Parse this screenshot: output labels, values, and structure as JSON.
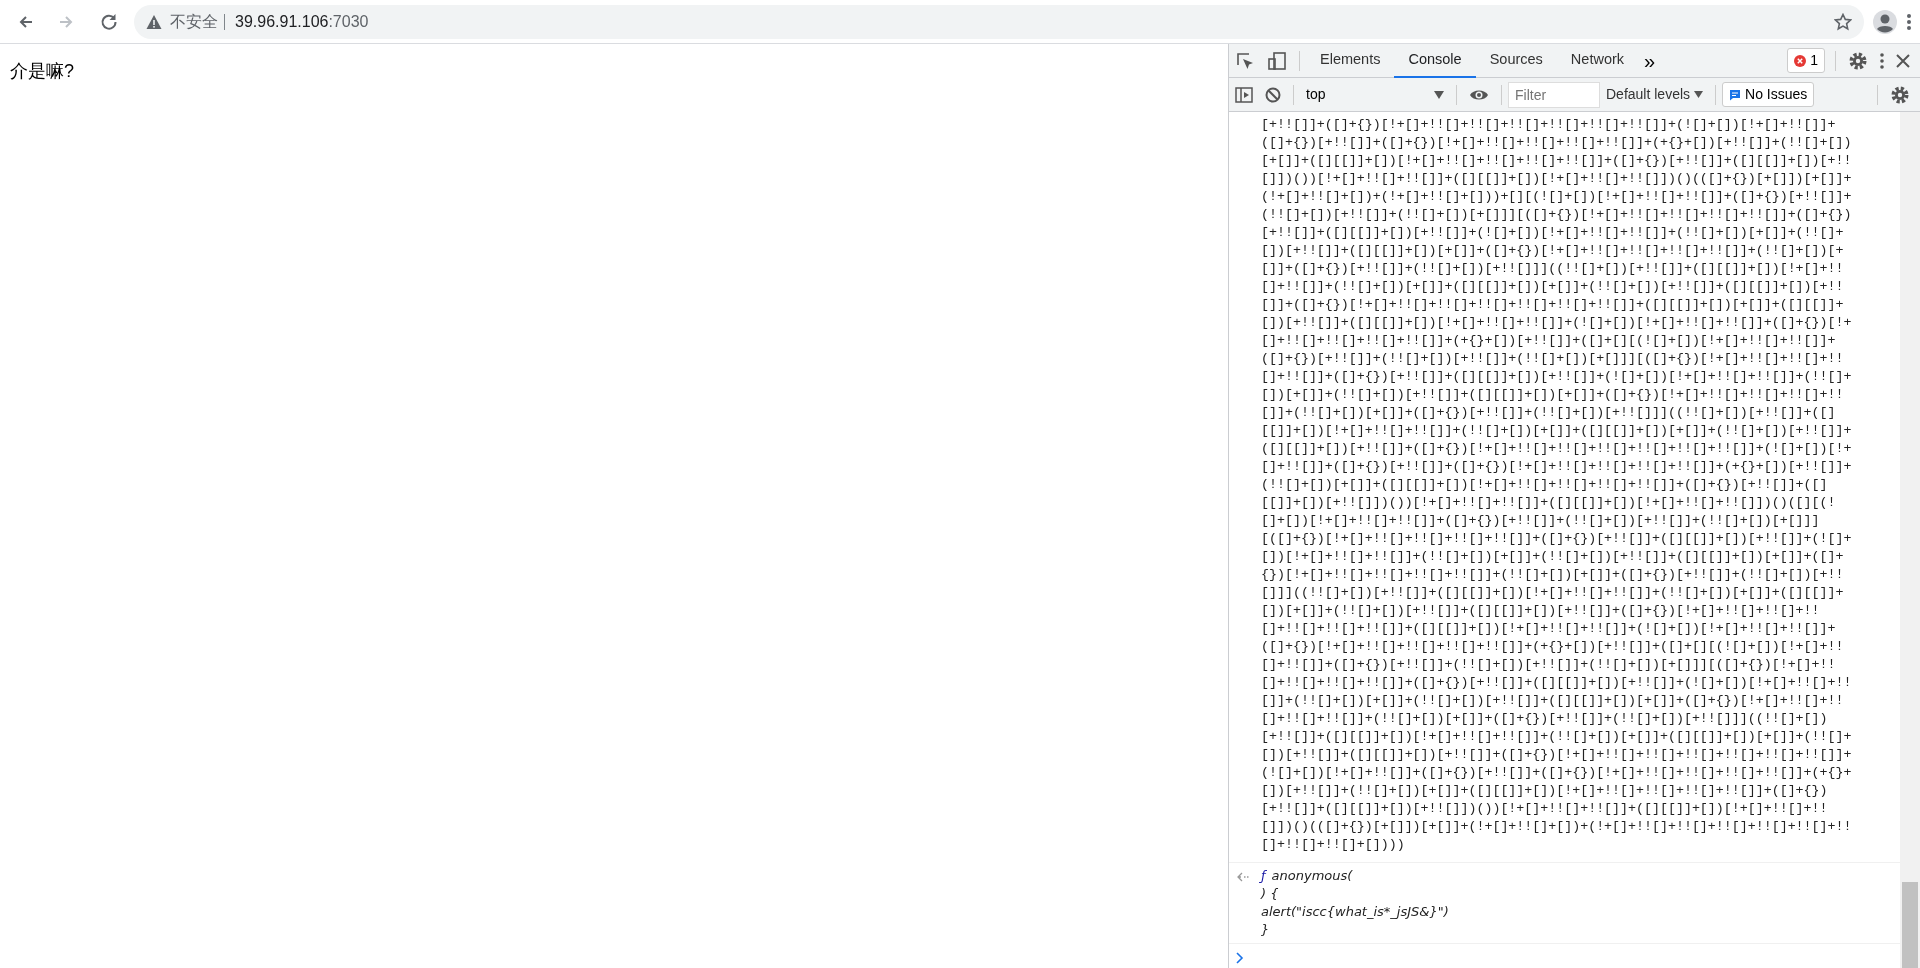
{
  "browser": {
    "navigation": [
      {
        "kind": "back",
        "disabled": false
      },
      {
        "kind": "forward",
        "disabled": true
      },
      {
        "kind": "reload",
        "disabled": false
      }
    ],
    "address": {
      "security_label": "不安全",
      "host": "39.96.91.106",
      "port": ":7030"
    }
  },
  "page": {
    "text": "介是嘛?"
  },
  "devtools": {
    "tabs": [
      {
        "label": "Elements",
        "selected": false
      },
      {
        "label": "Console",
        "selected": true
      },
      {
        "label": "Sources",
        "selected": false
      },
      {
        "label": "Network",
        "selected": false
      }
    ],
    "more": "»",
    "error_count": "1",
    "toolbar": {
      "context": "top",
      "filter": {
        "placeholder": "Filter"
      },
      "levels": "Default levels",
      "issues": "No Issues"
    },
    "console": {
      "code_lines": [
        "[+!![]]+([]+{})[!+[]+!![]+!![]+!![]+!![]+!![]+!![]]+(![]+[])[!+[]+!![]]+",
        "([]+{})[+!![]]+([]+{})[!+[]+!![]+!![]+!![]+!![]]+(+{}+[])[+!![]]+(!![]+[])",
        "[+[]]+([][[]]+[])[!+[]+!![]+!![]+!![]+!![]]+([]+{})[+!![]]+([][[]]+[])[+!!",
        "[]])())[!+[]+!![]+!![]]+([][[]]+[])[!+[]+!![]+!![]])()(([]+{})[+[]])[+[]]+",
        "(!+[]+!![]+[])+(!+[]+!![]+[]))+[][(![]+[])[!+[]+!![]+!![]]+([]+{})[+!![]]+",
        "(!![]+[])[+!![]]+(!![]+[])[+[]]][([]+{})[!+[]+!![]+!![]+!![]+!![]]+([]+{})",
        "[+!![]]+([][[]]+[])[+!![]]+(![]+[])[!+[]+!![]+!![]]+(!![]+[])[+[]]+(!![]+",
        "[])[+!![]]+([][[]]+[])[+[]]+([]+{})[!+[]+!![]+!![]+!![]+!![]]+(!![]+[])[+",
        "[]]+([]+{})[+!![]]+(!![]+[])[+!![]]]((!![]+[])[+!![]]+([][[]]+[])[!+[]+!!",
        "[]+!![]]+(!![]+[])[+[]]+([][[]]+[])[+[]]+(!![]+[])[+!![]]+([][[]]+[])[+!!",
        "[]]+([]+{})[!+[]+!![]+!![]+!![]+!![]+!![]+!![]]+([][[]]+[])[+[]]+([][[]]+",
        "[])[+!![]]+([][[]]+[])[!+[]+!![]+!![]]+(![]+[])[!+[]+!![]+!![]]+([]+{})[!+",
        "[]+!![]+!![]+!![]+!![]]+(+{}+[])[+!![]]+([]+[][(![]+[])[!+[]+!![]+!![]]+",
        "([]+{})[+!![]]+(!![]+[])[+!![]]+(!![]+[])[+[]]][([]+{})[!+[]+!![]+!![]+!!",
        "[]+!![]]+([]+{})[+!![]]+([][[]]+[])[+!![]]+(![]+[])[!+[]+!![]+!![]]+(!![]+",
        "[])[+[]]+(!![]+[])[+!![]]+([][[]]+[])[+[]]+([]+{})[!+[]+!![]+!![]+!![]+!!",
        "[]]+(!![]+[])[+[]]+([]+{})[+!![]]+(!![]+[])[+!![]]]((!![]+[])[+!![]]+([]",
        "[[]]+[])[!+[]+!![]+!![]]+(!![]+[])[+[]]+([][[]]+[])[+[]]+(!![]+[])[+!![]]+",
        "([][[]]+[])[+!![]]+([]+{})[!+[]+!![]+!![]+!![]+!![]+!![]+!![]]+(![]+[])[!+",
        "[]+!![]]+([]+{})[+!![]]+([]+{})[!+[]+!![]+!![]+!![]+!![]]+(+{}+[])[+!![]]+",
        "(!![]+[])[+[]]+([][[]]+[])[!+[]+!![]+!![]+!![]+!![]]+([]+{})[+!![]]+([]",
        "[[]]+[])[+!![]])())[!+[]+!![]+!![]]+([][[]]+[])[!+[]+!![]+!![]])()([][(!",
        "[]+[])[!+[]+!![]+!![]]+([]+{})[+!![]]+(!![]+[])[+!![]]+(!![]+[])[+[]]]",
        "[([]+{})[!+[]+!![]+!![]+!![]+!![]]+([]+{})[+!![]]+([][[]]+[])[+!![]]+(![]+",
        "[])[!+[]+!![]+!![]]+(!![]+[])[+[]]+(!![]+[])[+!![]]+([][[]]+[])[+[]]+([]+",
        "{})[!+[]+!![]+!![]+!![]+!![]]+(!![]+[])[+[]]+([]+{})[+!![]]+(!![]+[])[+!!",
        "[]]]((!![]+[])[+!![]]+([][[]]+[])[!+[]+!![]+!![]]+(!![]+[])[+[]]+([][[]]+",
        "[])[+[]]+(!![]+[])[+!![]]+([][[]]+[])[+!![]]+([]+{})[!+[]+!![]+!![]+!!",
        "[]+!![]+!![]+!![]]+([][[]]+[])[!+[]+!![]+!![]]+(![]+[])[!+[]+!![]+!![]]+",
        "([]+{})[!+[]+!![]+!![]+!![]+!![]]+(+{}+[])[+!![]]+([]+[][(![]+[])[!+[]+!!",
        "[]+!![]]+([]+{})[+!![]]+(!![]+[])[+!![]]+(!![]+[])[+[]]][([]+{})[!+[]+!!",
        "[]+!![]+!![]+!![]]+([]+{})[+!![]]+([][[]]+[])[+!![]]+(![]+[])[!+[]+!![]+!!",
        "[]]+(!![]+[])[+[]]+(!![]+[])[+!![]]+([][[]]+[])[+[]]+([]+{})[!+[]+!![]+!!",
        "[]+!![]+!![]]+(!![]+[])[+[]]+([]+{})[+!![]]+(!![]+[])[+!![]]]((!![]+[])",
        "[+!![]]+([][[]]+[])[!+[]+!![]+!![]]+(!![]+[])[+[]]+([][[]]+[])[+[]]+(!![]+",
        "[])[+!![]]+([][[]]+[])[+!![]]+([]+{})[!+[]+!![]+!![]+!![]+!![]+!![]+!![]]+",
        "(![]+[])[!+[]+!![]]+([]+{})[+!![]]+([]+{})[!+[]+!![]+!![]+!![]+!![]]+(+{}+",
        "[])[+!![]]+(!![]+[])[+[]]+([][[]]+[])[!+[]+!![]+!![]+!![]+!![]]+([]+{})",
        "[+!![]]+([][[]]+[])[+!![]])())[!+[]+!![]+!![]]+([][[]]+[])[!+[]+!![]+!!",
        "[]])()(([]+{})[+[]])[+[]]+(!+[]+!![]+[])+(!+[]+!![]+!![]+!![]+!![]+!![]+!!",
        "[]+!![]+!![]+[])))"
      ],
      "result": {
        "prefix": "ƒ",
        "lines": [
          "anonymous(",
          ") {",
          "alert(\"iscc{what_is*_jsJS&}\")",
          "}"
        ]
      }
    }
  }
}
